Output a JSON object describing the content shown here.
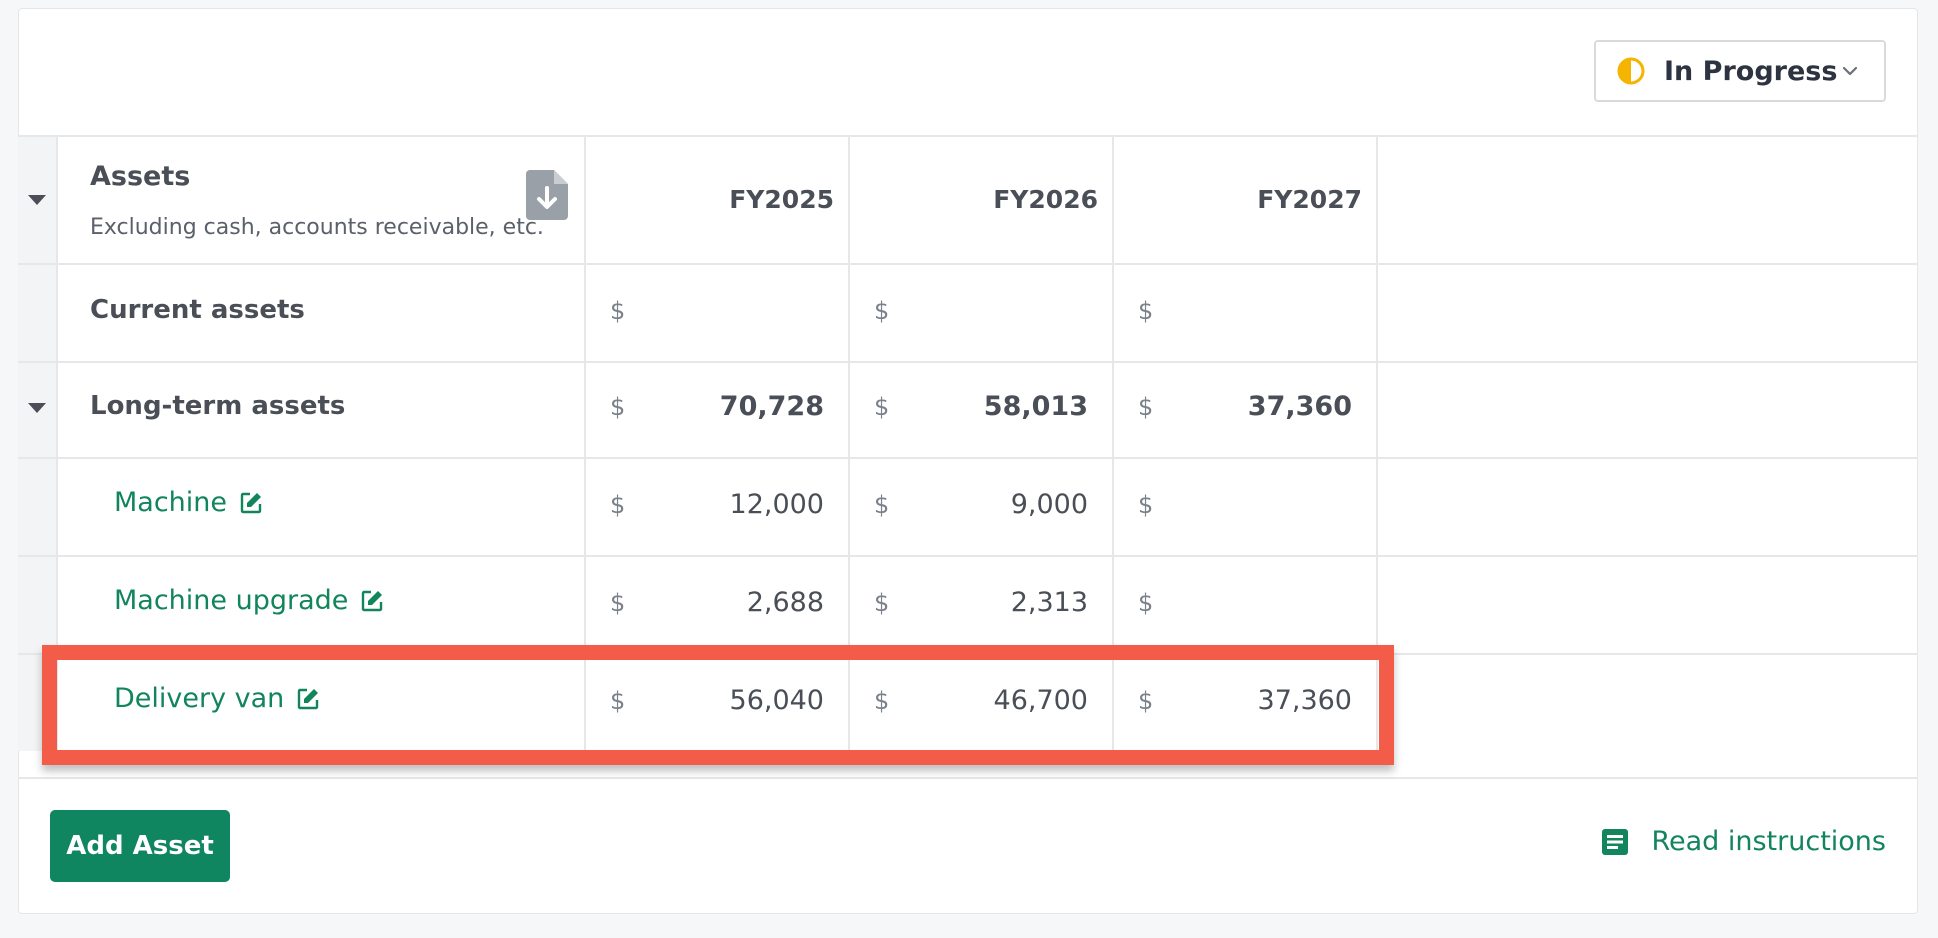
{
  "status": {
    "label": "In Progress",
    "accent": "#f5b400"
  },
  "header": {
    "title": "Assets",
    "subtitle": "Excluding cash, accounts receivable, etc.",
    "columns": [
      "FY2025",
      "FY2026",
      "FY2027"
    ]
  },
  "currency_symbol": "$",
  "rows": [
    {
      "label": "Current assets",
      "values": [
        "",
        "",
        ""
      ]
    },
    {
      "label": "Long-term assets",
      "values": [
        "70,728",
        "58,013",
        "37,360"
      ]
    },
    {
      "label": "Machine",
      "values": [
        "12,000",
        "9,000",
        ""
      ]
    },
    {
      "label": "Machine upgrade",
      "values": [
        "2,688",
        "2,313",
        ""
      ]
    },
    {
      "label": "Delivery van",
      "values": [
        "56,040",
        "46,700",
        "37,360"
      ]
    }
  ],
  "footer": {
    "add_button": "Add Asset",
    "read_link": "Read instructions"
  },
  "colors": {
    "brand_green": "#0f8560",
    "highlight": "#f45c4a"
  }
}
